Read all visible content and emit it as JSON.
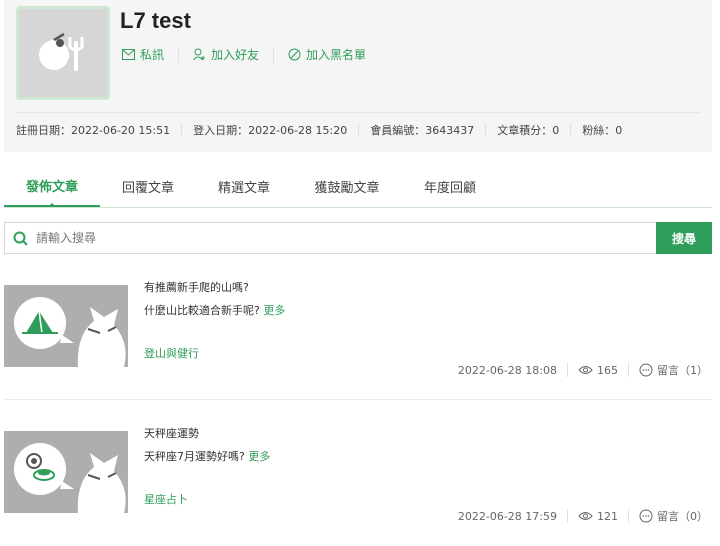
{
  "profile": {
    "username": "L7 test",
    "actions": {
      "message": "私訊",
      "add_friend": "加入好友",
      "blacklist": "加入黑名單"
    },
    "stats": {
      "register": "註冊日期：2022-06-20 15:51",
      "login": "登入日期：2022-06-28 15:20",
      "member_id": "會員編號：3643437",
      "articles": "文章積分：0",
      "fans": "粉絲：0"
    }
  },
  "tabs": [
    "發佈文章",
    "回覆文章",
    "精選文章",
    "獲鼓勵文章",
    "年度回顧"
  ],
  "search": {
    "placeholder": "請輸入搜尋",
    "button": "搜尋"
  },
  "articles": [
    {
      "title": "有推薦新手爬的山嗎?",
      "summary": "什麼山比較適合新手呢?",
      "more": "更多",
      "category": "登山與健行",
      "date": "2022-06-28 18:08",
      "views": "165",
      "comments": "留言（1）",
      "thumb_icon": "tent-icon"
    },
    {
      "title": "天秤座運勢",
      "summary": "天秤座7月運勢好嗎?",
      "more": "更多",
      "category": "星座占卜",
      "date": "2022-06-28 17:59",
      "views": "121",
      "comments": "留言（0）",
      "thumb_icon": "compact-mirror-icon"
    }
  ],
  "colors": {
    "accent": "#2f9e5a",
    "background": "#f5f5f5"
  }
}
